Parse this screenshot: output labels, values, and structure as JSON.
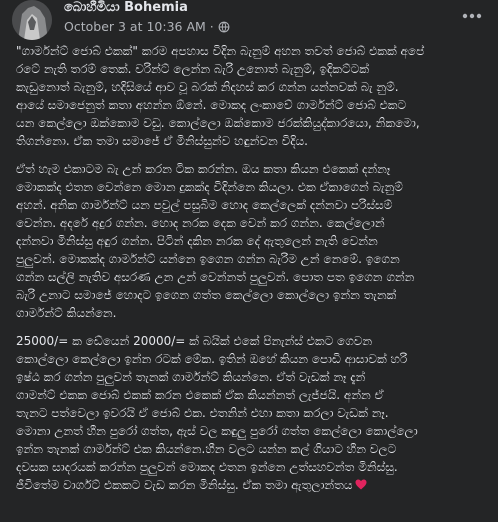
{
  "post": {
    "author": "බොහීමියා Bohemia",
    "timestamp": "October 3 at 10:36 AM",
    "separator": "·",
    "privacy_icon": "globe-icon",
    "more_icon": "more-options-icon",
    "paragraphs": [
      "\"ගාර්මන්ට් ජොබ් එකක්\" කරම අපහාස විදින බැනුම් අහන තවත් ජොබ් එකක් අපේ\nරටේ නැති තරම් තෙක්. වරින්ට් ලෙන්න බැරි උනොත් බැනුම්, ඉදිකට්ටක්\nකැඩුනොත් බැනුම්, හදිසියේ ආව වූ බරක් නිදහස් කර ගන්න යන්නවක් බැ නුම්.\nආයේ සමාජෙනුත් කතා අහන්න ඕනේ. මොකද ලංකාවේ ගාර්මන්ට් ජොබ් එකට\nයන කෙල්ලො ඔක්කොම වඩු. කොල්ලො ඔක්කොම ජරක්කියුද්කාරයො, නිකමො,\nතිගන්නො. ඒක තමා සමාජේ ඒ මිනිස්සුන්ව හඳුන්වන විදිය.",
      "ඒත් හැම එකාටම බැ උන් කරන ටික කරන්න. ඔය කතා කියන එකෙක් දන්නෑ\nමොකක්ද එතන වෙන්නෙ මොන දුකක්ද විදින්නෙ කියලා. එක ඒකාගෙන් බැනුම්\nඅහන්. අනික ගාර්මන්ට් යන පවුල් පසුබිම හොද කෙල්ලෙක් දන්නවා පරිස්සම්\nවෙන්න. අදරේ අදුර ගන්න. හොද නරක දෙක වෙන් කර ගන්න. කෙල්ලොන්\nදන්නවා මිනිස්සු අඳුර ගන්න. පිටින් දකින නරක දේ ඇතුලෙන් නැති වෙන්න\nපුලුවන්. මොකක්ද ගාර්මන්ට් යන්නෙ ඉගෙන ගන්න බැරිම උන් නෙමේ. ඉගෙන\nගන්න සල්ලි නැතිව අසරණ උන උන් වෙන්නත් පුලුවන්. පොත පත ඉගෙන ගන්න\nබැරි උනාට සමාජේ හොදට ඉගෙන ගත්ත කෙල්ලො කොල්ලො ඉන්න තැනක්\nගාර්මන්ට් කියන්නෙ.",
      "25000/= ක ඩේයෙන් 20000/= ක් බයික් එකේ පිනැන්ස් එකට ගෙවන\nකොල්ලො කෙල්ලො ඉන්න රටක් මේක. ඉතින් ඔහේ කියන පොඩි ආසාවක් හරි\nඉෂ්ඨ කර ගන්න පුලුවන් තැනක් ගාර්මන්ට් කියන්නෙ. ඒත් වැඩක් නෑ දැන්\nගාමන්ට් එකක ජොබ් එකක් කරන එකෙක් ඒක කියන්නත් ලැජ්ජයි. අන්න ඒ\nතැනට පත්වෙලා ඉවරයි ඒ ජොබ් එක. එතනින් එහා කතා කරලා වැඩක් නෑ.\nමොනා උනත් හීන පුරෝ ගත්ත, ඇස් වල කඳුලු පුරෝ ගත්ත කෙල්ලො කොල්ලො\nඉන්න තැනක් ගාර්මන්ට් එක කියන්නෙ.හීන වලට යන්න කල් ගියාට හීන වලට\nදවසක සාදරයක් කරන්න පුලුවන් මොකද එතන ඉන්නෙ උත්සහවන්ත මිනිස්සු.\nජීවිතේම වාර්ගට් එකකට වැඩ කරන මිනිස්සු. ඒක තමා ඇතුලාන්තය"
    ],
    "end_emoji": "heart-icon",
    "colors": {
      "background": "#242526",
      "text_primary": "#e4e6eb",
      "text_secondary": "#b0b3b8",
      "heart": "#e0245e"
    }
  }
}
